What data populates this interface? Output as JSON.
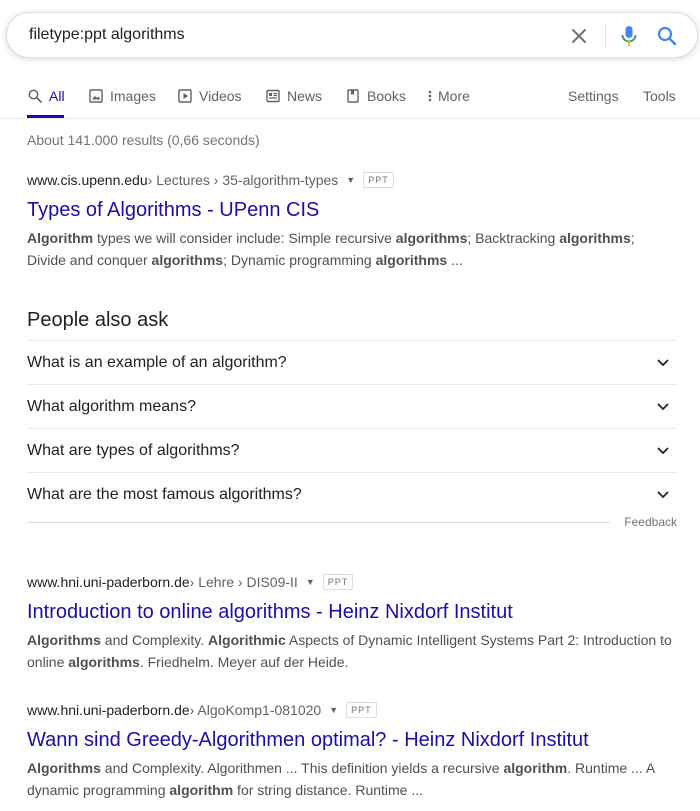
{
  "search": {
    "query": "filetype:ppt algorithms"
  },
  "tabs": [
    {
      "label": "All",
      "icon": "search-icon"
    },
    {
      "label": "Images",
      "icon": "image-icon"
    },
    {
      "label": "Videos",
      "icon": "video-icon"
    },
    {
      "label": "News",
      "icon": "news-icon"
    },
    {
      "label": "Books",
      "icon": "book-icon"
    },
    {
      "label": "More",
      "icon": "more-vert-icon"
    }
  ],
  "tools": {
    "settings": "Settings",
    "tools": "Tools"
  },
  "stats": "About 141.000 results (0,66 seconds)",
  "badge_label": "PPT",
  "results": [
    {
      "domain": "www.cis.upenn.edu",
      "path": " › Lectures › 35-algorithm-types",
      "title": "Types of Algorithms - UPenn CIS",
      "snippet_html": "<b>Algorithm</b> types we will consider include: Simple recursive <b>algorithms</b>; Backtracking <b>algorithms</b>; Divide and conquer <b>algorithms</b>; Dynamic programming <b>algorithms</b> ..."
    },
    {
      "domain": "www.hni.uni-paderborn.de",
      "path": " › Lehre › DIS09-II",
      "title": "Introduction to online algorithms - Heinz Nixdorf Institut",
      "snippet_html": "<b>Algorithms</b> and Complexity. <b>Algorithmic</b> Aspects of Dynamic Intelligent Systems Part 2: Introduction to online <b>algorithms</b>. Friedhelm. Meyer auf der Heide."
    },
    {
      "domain": "www.hni.uni-paderborn.de",
      "path": " › AlgoKomp1-081020",
      "title": "Wann sind Greedy-Algorithmen optimal? - Heinz Nixdorf Institut",
      "snippet_html": "<b>Algorithms</b> and Complexity. Algorithmen ... This definition yields a recursive <b>algorithm</b>. Runtime ... A dynamic programming <b>algorithm</b> for string distance. Runtime ..."
    }
  ],
  "people_also_ask": {
    "title": "People also ask",
    "questions": [
      "What is an example of an algorithm?",
      "What algorithm means?",
      "What are types of algorithms?",
      "What are the most famous algorithms?"
    ],
    "feedback": "Feedback"
  },
  "colors": {
    "link": "#1a0dab",
    "muted": "#70757a",
    "snippet": "#4d5156"
  }
}
